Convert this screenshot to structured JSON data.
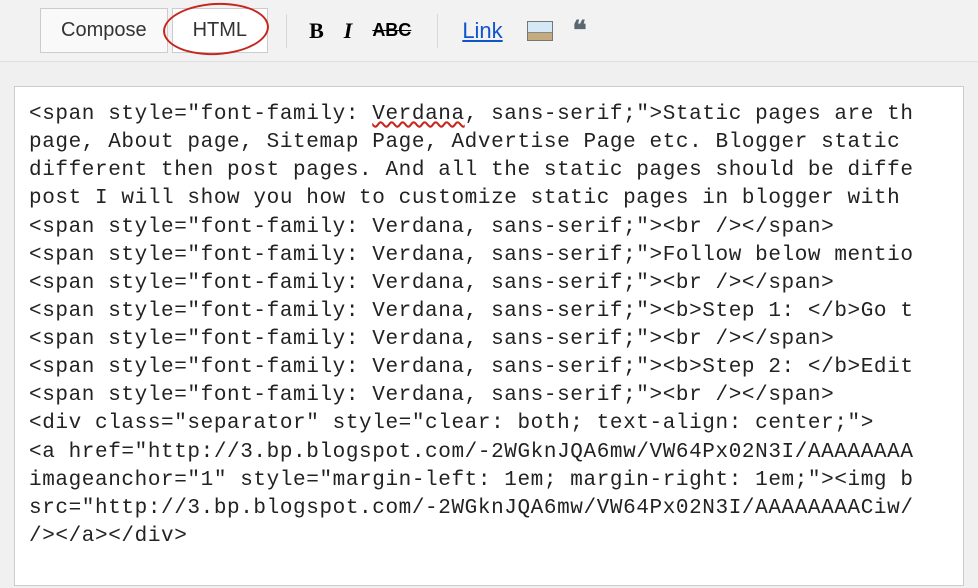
{
  "toolbar": {
    "compose_label": "Compose",
    "html_label": "HTML",
    "bold_label": "B",
    "italic_label": "I",
    "strike_label": "ABC",
    "link_label": "Link",
    "quote_glyph": "❝"
  },
  "editor": {
    "lines": [
      {
        "pre": "<span style=\"font-family: ",
        "word": "Verdana",
        "post": ", sans-serif;\">Static pages are th"
      },
      {
        "pre": "page, About page, Sitemap Page, Advertise Page etc. Blogger static ",
        "word": "",
        "post": ""
      },
      {
        "pre": "different then post pages. And all the static pages should be diffe",
        "word": "",
        "post": ""
      },
      {
        "pre": "post I will show you how to customize static pages in blogger with ",
        "word": "",
        "post": ""
      },
      {
        "pre": "<span style=\"font-family: Verdana, sans-serif;\"><br /></span>",
        "word": "",
        "post": ""
      },
      {
        "pre": "<span style=\"font-family: Verdana, sans-serif;\">Follow below mentio",
        "word": "",
        "post": ""
      },
      {
        "pre": "<span style=\"font-family: Verdana, sans-serif;\"><br /></span>",
        "word": "",
        "post": ""
      },
      {
        "pre": "<span style=\"font-family: Verdana, sans-serif;\"><b>Step 1: </b>Go t",
        "word": "",
        "post": ""
      },
      {
        "pre": "<span style=\"font-family: Verdana, sans-serif;\"><br /></span>",
        "word": "",
        "post": ""
      },
      {
        "pre": "<span style=\"font-family: Verdana, sans-serif;\"><b>Step 2: </b>Edit",
        "word": "",
        "post": ""
      },
      {
        "pre": "<span style=\"font-family: Verdana, sans-serif;\"><br /></span>",
        "word": "",
        "post": ""
      },
      {
        "pre": "<div class=\"separator\" style=\"clear: both; text-align: center;\">",
        "word": "",
        "post": ""
      },
      {
        "pre": "<a href=\"http://3.bp.blogspot.com/-2WGknJQA6mw/VW64Px02N3I/AAAAAAAA",
        "word": "",
        "post": ""
      },
      {
        "pre": "imageanchor=\"1\" style=\"margin-left: 1em; margin-right: 1em;\"><img b",
        "word": "",
        "post": ""
      },
      {
        "pre": "src=\"http://3.bp.blogspot.com/-2WGknJQA6mw/VW64Px02N3I/AAAAAAAACiw/",
        "word": "",
        "post": ""
      },
      {
        "pre": "/></a></div>",
        "word": "",
        "post": ""
      }
    ]
  }
}
